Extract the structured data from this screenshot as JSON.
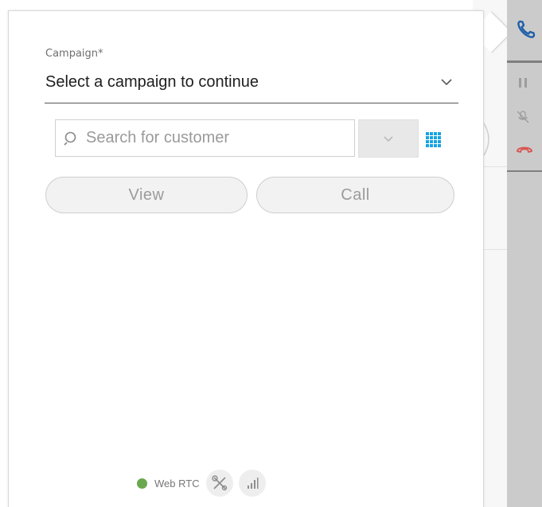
{
  "campaign": {
    "label": "Campaign*",
    "selected_value": "Select a campaign to continue"
  },
  "search": {
    "placeholder": "Search for customer"
  },
  "actions": {
    "view_label": "View",
    "call_label": "Call"
  },
  "status": {
    "connection_label": "Web RTC",
    "connection_color": "#6aa84f"
  },
  "icons": {
    "campaign_dropdown": "chevron-down-icon",
    "search": "search-icon",
    "search_filter": "chevron-down-icon",
    "dialpad": "dialpad-grid-icon",
    "transfer": "tools-icon",
    "signal": "signal-bars-icon",
    "phone": "phone-icon",
    "hold": "pause-icon",
    "mute": "mic-off-icon",
    "hangup": "hangup-icon"
  },
  "colors": {
    "accent_blue": "#1aa3e0",
    "phone_blue": "#1f5fa8",
    "hangup_red": "#d9534f",
    "status_green": "#6aa84f"
  }
}
